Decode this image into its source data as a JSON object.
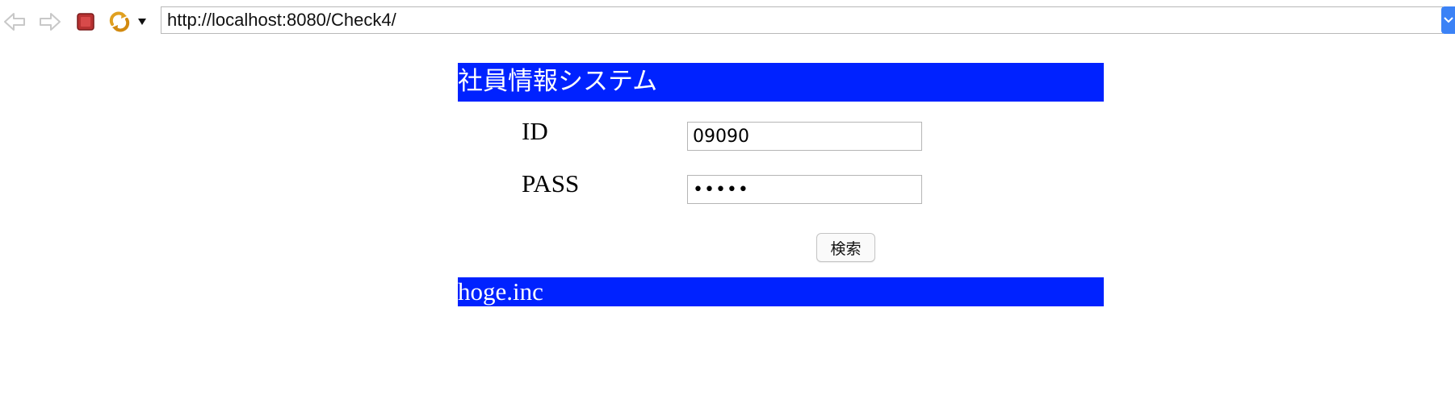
{
  "browser": {
    "url": "http://localhost:8080/Check4/",
    "icons": {
      "back": "back-arrow-icon",
      "forward": "forward-arrow-icon",
      "stop": "stop-icon",
      "refresh": "refresh-icon",
      "menu": "dropdown-arrow-icon"
    }
  },
  "page": {
    "header_title": "社員情報システム",
    "footer_text": "hoge.inc"
  },
  "form": {
    "id_label": "ID",
    "id_value": "09090",
    "pass_label": "PASS",
    "pass_value": "•••••",
    "submit_label": "検索"
  },
  "colors": {
    "band": "#0022ff",
    "band_text": "#ffffff"
  }
}
